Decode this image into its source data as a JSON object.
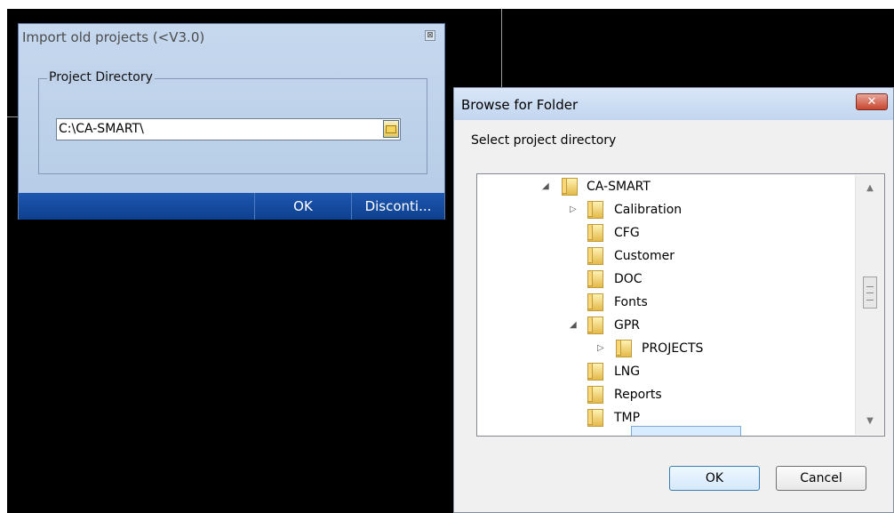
{
  "import_dialog": {
    "title": "Import old projects (<V3.0)",
    "group_label": "Project Directory",
    "path_value": "C:\\CA-SMART\\",
    "buttons": {
      "ok": "OK",
      "disconnect": "Disconti..."
    }
  },
  "browse_dialog": {
    "title": "Browse for Folder",
    "close_label": "✕",
    "prompt": "Select project directory",
    "tree": [
      {
        "label": "CA-SMART",
        "expanded": true,
        "selected": false
      },
      {
        "label": "Calibration",
        "expanded": false,
        "selected": false
      },
      {
        "label": "CFG",
        "expanded": false,
        "selected": false
      },
      {
        "label": "Customer",
        "expanded": false,
        "selected": false
      },
      {
        "label": "DOC",
        "expanded": false,
        "selected": false
      },
      {
        "label": "Fonts",
        "expanded": false,
        "selected": false
      },
      {
        "label": "GPR",
        "expanded": true,
        "selected": false
      },
      {
        "label": "PROJECTS",
        "expanded": false,
        "selected": true
      },
      {
        "label": "LNG",
        "expanded": false,
        "selected": false
      },
      {
        "label": "Reports",
        "expanded": false,
        "selected": false
      },
      {
        "label": "TMP",
        "expanded": false,
        "selected": false
      }
    ],
    "buttons": {
      "ok": "OK",
      "cancel": "Cancel"
    }
  },
  "icons": {
    "close": "close-icon",
    "folder": "folder-icon",
    "expand_arrow": "expand-arrow-icon",
    "collapse_arrow": "collapse-arrow-icon",
    "scroll_up": "scroll-up-icon",
    "scroll_down": "scroll-down-icon"
  },
  "colors": {
    "dialog_blue": "#c6d8ee",
    "footer_blue": "#1e58b0",
    "selection_blue": "#d7ecff",
    "close_red": "#c8472f"
  }
}
